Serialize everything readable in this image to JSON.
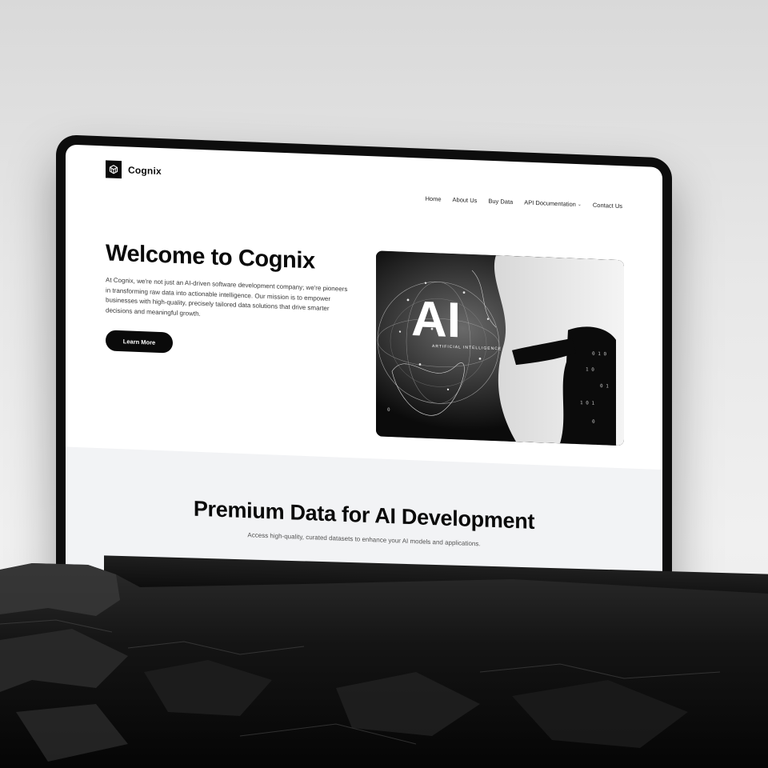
{
  "brand": {
    "name": "Cognix",
    "logo_icon": "cube-logo-icon"
  },
  "nav": {
    "items": [
      {
        "label": "Home"
      },
      {
        "label": "About Us"
      },
      {
        "label": "Buy Data"
      },
      {
        "label": "API Documentation",
        "has_dropdown": true
      },
      {
        "label": "Contact Us"
      }
    ]
  },
  "hero": {
    "title": "Welcome to Cognix",
    "body": "At Cognix, we're not just an AI-driven software development company; we're pioneers in transforming raw data into actionable intelligence. Our mission is to empower businesses with high-quality, precisely tailored data solutions that drive smarter decisions and meaningful growth.",
    "cta_label": "Learn More",
    "image": {
      "badge": "AI",
      "caption": "ARTIFICIAL INTELLIGENCE"
    }
  },
  "section2": {
    "title": "Premium Data for AI Development",
    "subtitle": "Access high-quality, curated datasets to enhance your AI models and applications."
  },
  "colors": {
    "accent": "#0a0a0a",
    "page_bg": "#ffffff",
    "section_bg": "#f2f3f5",
    "device": "#0d0d0d"
  }
}
